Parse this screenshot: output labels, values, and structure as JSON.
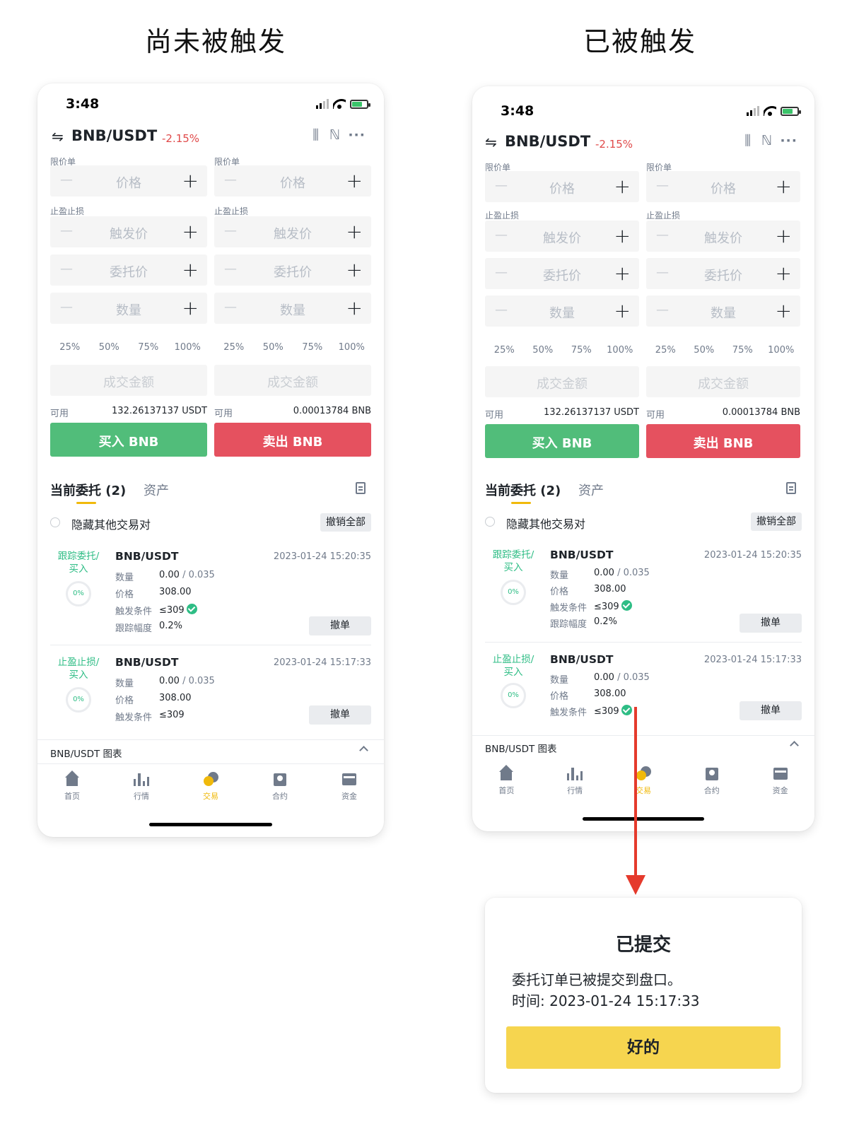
{
  "headings": {
    "left": "尚未被触发",
    "right": "已被触发"
  },
  "status": {
    "time": "3:48"
  },
  "header": {
    "swap_glyph": "⇋",
    "pair": "BNB/USDT",
    "change": "-2.15%"
  },
  "form": {
    "limit_label": "限价单",
    "stop_label": "止盈止损",
    "price_ph": "价格",
    "trigger_ph": "触发价",
    "order_price_ph": "委托价",
    "qty_ph": "数量",
    "percents": [
      "25%",
      "50%",
      "75%",
      "100%"
    ],
    "amount_ph": "成交金额",
    "avail_label": "可用",
    "buy_avail": "132.26137137 USDT",
    "sell_avail": "0.00013784 BNB",
    "buy_btn": "买入 BNB",
    "sell_btn": "卖出 BNB",
    "minus": "—",
    "plus": "+"
  },
  "orders_tabs": {
    "current": "当前委托 (2)",
    "assets": "资产"
  },
  "hide_other": "隐藏其他交易对",
  "cancel_all": "撤销全部",
  "orders": [
    {
      "type_line1": "跟踪委托/",
      "type_line2": "买入",
      "progress": "0%",
      "pair": "BNB/USDT",
      "time": "2023-01-24 15:20:35",
      "qty_label": "数量",
      "qty_filled": "0.00",
      "qty_total": " / 0.035",
      "price_label": "价格",
      "price": "308.00",
      "trigger_label": "触发条件",
      "trigger": "≤309",
      "trail_label": "跟踪幅度",
      "trail": "0.2%",
      "cancel": "撤单"
    },
    {
      "type_line1": "止盈止损/",
      "type_line2": "买入",
      "progress": "0%",
      "pair": "BNB/USDT",
      "time": "2023-01-24 15:17:33",
      "qty_label": "数量",
      "qty_filled": "0.00",
      "qty_total": " / 0.035",
      "price_label": "价格",
      "price": "308.00",
      "trigger_label": "触发条件",
      "trigger": "≤309",
      "cancel": "撤单"
    }
  ],
  "chart_bar": "BNB/USDT 图表",
  "nav": [
    "首页",
    "行情",
    "交易",
    "合约",
    "资金"
  ],
  "dialog": {
    "title": "已提交",
    "message": "委托订单已被提交到盘口。",
    "time": "时间: 2023-01-24 15:17:33",
    "ok": "好的"
  },
  "colors": {
    "buy": "#51bd7a",
    "sell": "#e5515f",
    "accent": "#f0b90b",
    "arrow": "#e53a2c",
    "ok_button": "#f6d54f"
  },
  "icons": [
    "swap-icon",
    "candlestick-icon",
    "indicator-icon",
    "more-icon",
    "order-history-icon",
    "home-icon",
    "markets-icon",
    "trade-icon",
    "futures-icon",
    "wallet-icon",
    "check-icon",
    "chevron-up-icon"
  ]
}
